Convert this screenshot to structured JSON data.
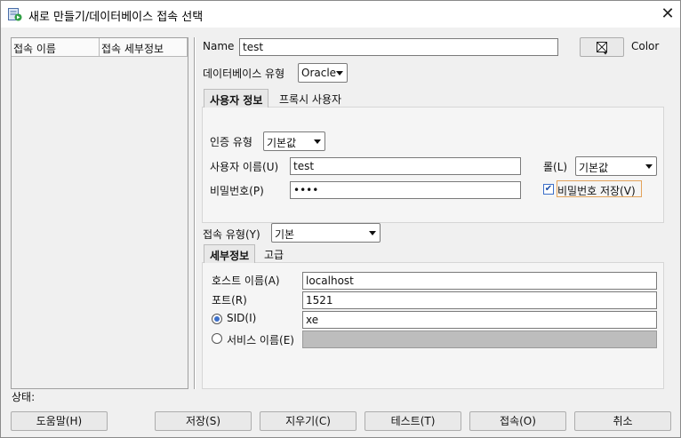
{
  "window": {
    "title": "새로 만들기/데이터베이스 접속 선택",
    "close": "✕"
  },
  "connection_list": {
    "columns": [
      "접속 이름",
      "접속 세부정보"
    ],
    "rows": []
  },
  "form": {
    "name_label": "Name",
    "name_value": "test",
    "color_label": "Color",
    "db_type_label": "데이터베이스 유형",
    "db_type_value": "Oracle"
  },
  "auth_tabs": [
    "사용자 정보",
    "프록시 사용자"
  ],
  "auth": {
    "auth_type_label": "인증 유형",
    "auth_type_value": "기본값",
    "username_label": "사용자 이름(U)",
    "username_value": "test",
    "role_label": "롤(L)",
    "role_value": "기본값",
    "password_label": "비밀번호(P)",
    "password_value": "••••",
    "save_password_label": "비밀번호 저장(V)",
    "save_password_checked": true
  },
  "connection": {
    "type_label": "접속 유형(Y)",
    "type_value": "기본"
  },
  "detail_tabs": [
    "세부정보",
    "고급"
  ],
  "details": {
    "host_label": "호스트 이름(A)",
    "host_value": "localhost",
    "port_label": "포트(R)",
    "port_value": "1521",
    "sid_label": "SID(I)",
    "sid_value": "xe",
    "service_label": "서비스 이름(E)",
    "service_value": ""
  },
  "status_label": "상태:",
  "buttons": {
    "help": "도움말(H)",
    "save": "저장(S)",
    "clear": "지우기(C)",
    "test": "테스트(T)",
    "connect": "접속(O)",
    "cancel": "취소"
  }
}
